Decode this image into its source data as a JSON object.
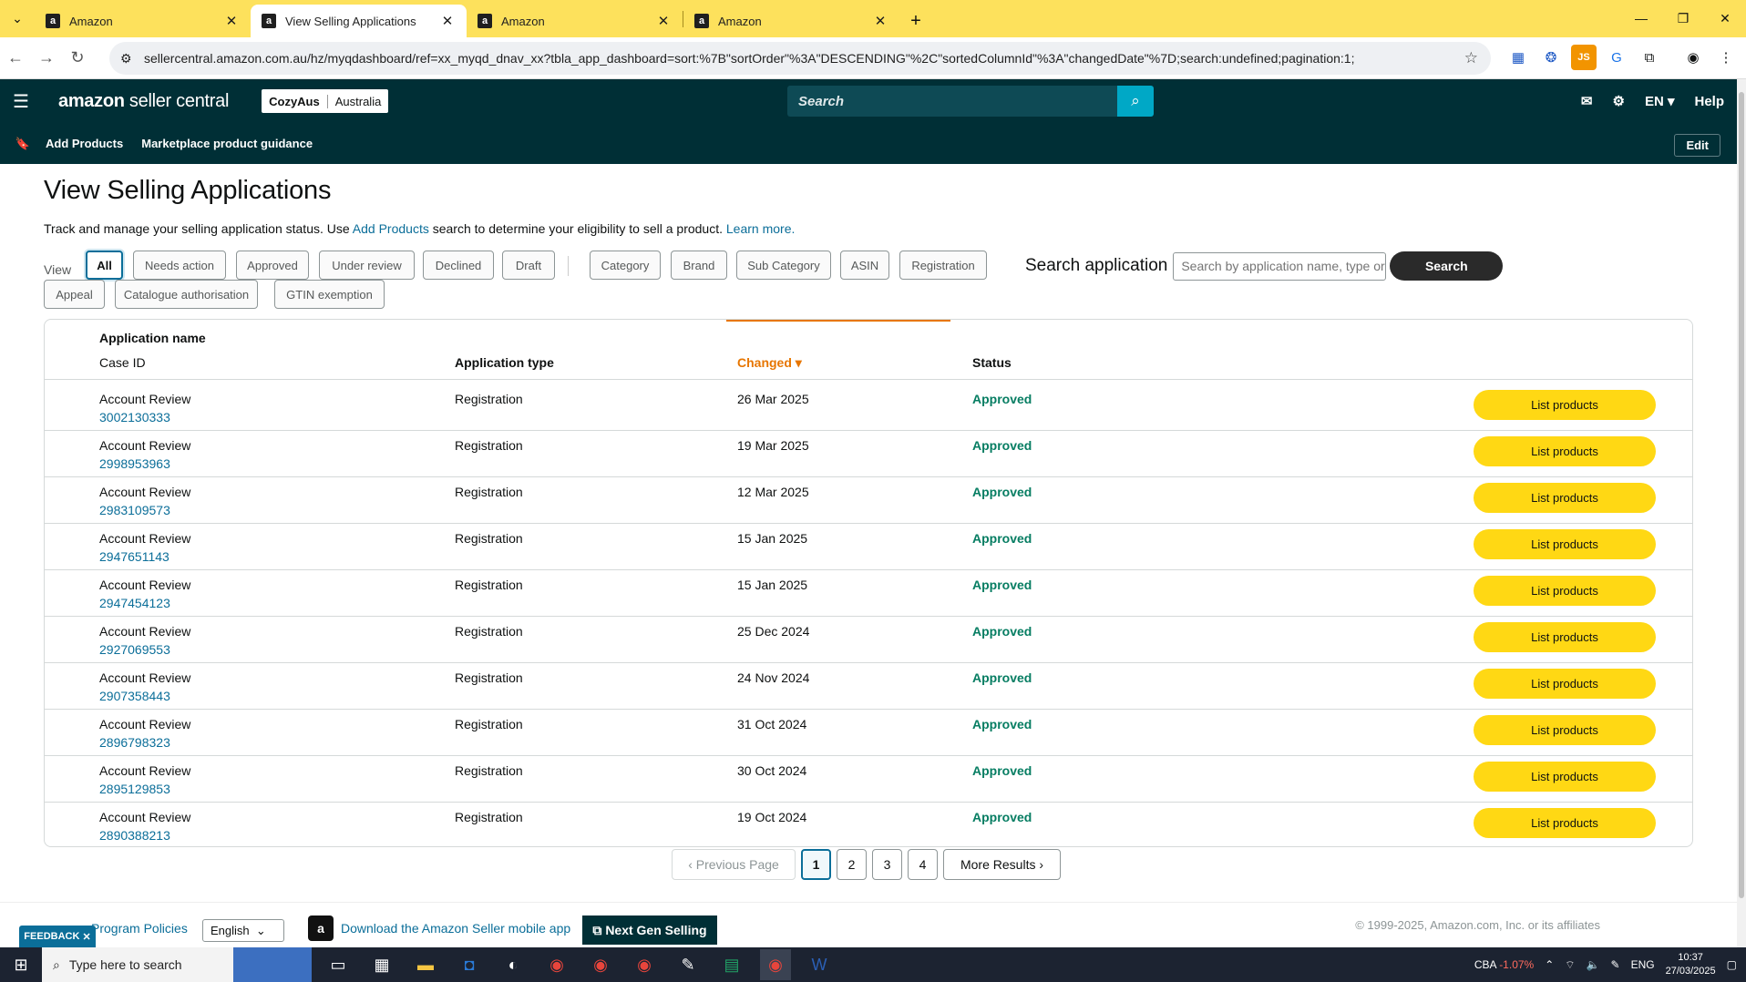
{
  "browser": {
    "tabs": [
      {
        "label": "Amazon",
        "favicon": "a"
      },
      {
        "label": "View Selling Applications",
        "favicon": "a"
      },
      {
        "label": "Amazon",
        "favicon": "a"
      },
      {
        "label": "Amazon",
        "favicon": "a"
      }
    ],
    "active_tab_index": 1,
    "url": "sellercentral.amazon.com.au/hz/myqdashboard/ref=xx_myqd_dnav_xx?tbla_app_dashboard=sort:%7B\"sortOrder\"%3A\"DESCENDING\"%2C\"sortedColumnId\"%3A\"changedDate\"%7D;search:undefined;pagination:1;"
  },
  "header": {
    "logo_text": "amazon",
    "logo_suffix": " seller central",
    "store_name": "CozyAus",
    "store_region": "Australia",
    "search_placeholder": "Search",
    "language": "EN",
    "help": "Help"
  },
  "subnav": {
    "items": [
      "Add Products",
      "Marketplace product guidance"
    ],
    "edit": "Edit"
  },
  "page": {
    "title": "View Selling Applications",
    "desc_prefix": "Track and manage your selling application status. Use ",
    "desc_link": "Add Products",
    "desc_mid": " search to determine your eligibility to sell a product. ",
    "desc_learn": "Learn more.",
    "view_label": "View",
    "filters_row1": [
      "All",
      "Needs action",
      "Approved",
      "Under review",
      "Declined",
      "Draft"
    ],
    "filters_group2": [
      "Category",
      "Brand",
      "Sub Category",
      "ASIN",
      "Registration"
    ],
    "filters_row2": [
      "Appeal",
      "Catalogue authorisation",
      "GTIN exemption"
    ],
    "search_label": "Search application",
    "search_placeholder": "Search by application name, type or",
    "search_button": "Search"
  },
  "table": {
    "headers": {
      "app_name": "Application name",
      "case_id": "Case ID",
      "app_type": "Application type",
      "changed": "Changed",
      "status": "Status"
    },
    "rows": [
      {
        "name": "Account Review",
        "case": "3002130333",
        "type": "Registration",
        "changed": "26 Mar 2025",
        "status": "Approved",
        "action": "List products"
      },
      {
        "name": "Account Review",
        "case": "2998953963",
        "type": "Registration",
        "changed": "19 Mar 2025",
        "status": "Approved",
        "action": "List products"
      },
      {
        "name": "Account Review",
        "case": "2983109573",
        "type": "Registration",
        "changed": "12 Mar 2025",
        "status": "Approved",
        "action": "List products"
      },
      {
        "name": "Account Review",
        "case": "2947651143",
        "type": "Registration",
        "changed": "15 Jan 2025",
        "status": "Approved",
        "action": "List products"
      },
      {
        "name": "Account Review",
        "case": "2947454123",
        "type": "Registration",
        "changed": "15 Jan 2025",
        "status": "Approved",
        "action": "List products"
      },
      {
        "name": "Account Review",
        "case": "2927069553",
        "type": "Registration",
        "changed": "25 Dec 2024",
        "status": "Approved",
        "action": "List products"
      },
      {
        "name": "Account Review",
        "case": "2907358443",
        "type": "Registration",
        "changed": "24 Nov 2024",
        "status": "Approved",
        "action": "List products"
      },
      {
        "name": "Account Review",
        "case": "2896798323",
        "type": "Registration",
        "changed": "31 Oct 2024",
        "status": "Approved",
        "action": "List products"
      },
      {
        "name": "Account Review",
        "case": "2895129853",
        "type": "Registration",
        "changed": "30 Oct 2024",
        "status": "Approved",
        "action": "List products"
      },
      {
        "name": "Account Review",
        "case": "2890388213",
        "type": "Registration",
        "changed": "19 Oct 2024",
        "status": "Approved",
        "action": "List products"
      }
    ]
  },
  "pagination": {
    "prev": "Previous Page",
    "pages": [
      "1",
      "2",
      "3",
      "4"
    ],
    "current": "1",
    "more": "More Results"
  },
  "footer": {
    "feedback": "FEEDBACK",
    "policies": "Program Policies",
    "language": "English",
    "app_download": "Download the Amazon Seller mobile app",
    "next_gen": "Next Gen Selling",
    "copyright": "© 1999-2025, Amazon.com, Inc. or its affiliates"
  },
  "taskbar": {
    "search_placeholder": "Type here to search",
    "ticker": "CBA",
    "ticker_change": "-1.07%",
    "lang": "ENG",
    "time": "10:37",
    "date": "27/03/2025"
  },
  "colors": {
    "header": "#002f36",
    "accent": "#e77600",
    "approved": "#067d62",
    "button": "#ffd814",
    "tabbar": "#fde15c"
  }
}
